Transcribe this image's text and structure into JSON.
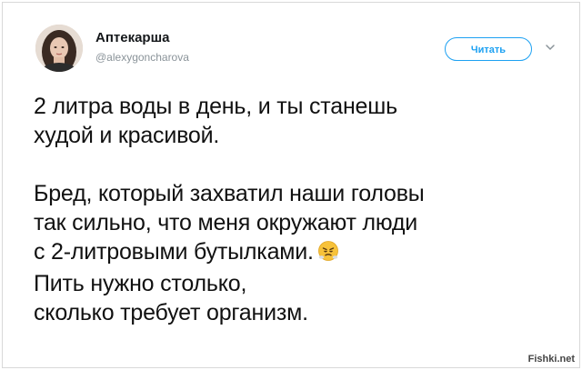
{
  "author": {
    "display_name": "Аптекарша",
    "handle": "@alexygoncharova"
  },
  "follow_button": {
    "label": "Читать"
  },
  "icons": {
    "more": "chevron-down-icon",
    "emoji": "face-with-steam-from-nose-icon"
  },
  "tweet": {
    "lines": [
      "2 литра воды в день, и ты станешь",
      "худой и красивой.",
      "Бред, который захватил наши головы",
      "так сильно, что меня окружают люди",
      "с 2-литровыми бутылками.",
      "Пить нужно столько,",
      "сколько требует организм."
    ]
  },
  "watermark": "Fishki.net",
  "colors": {
    "accent": "#1da1f2",
    "text": "#14171a",
    "muted": "#8a9399"
  }
}
